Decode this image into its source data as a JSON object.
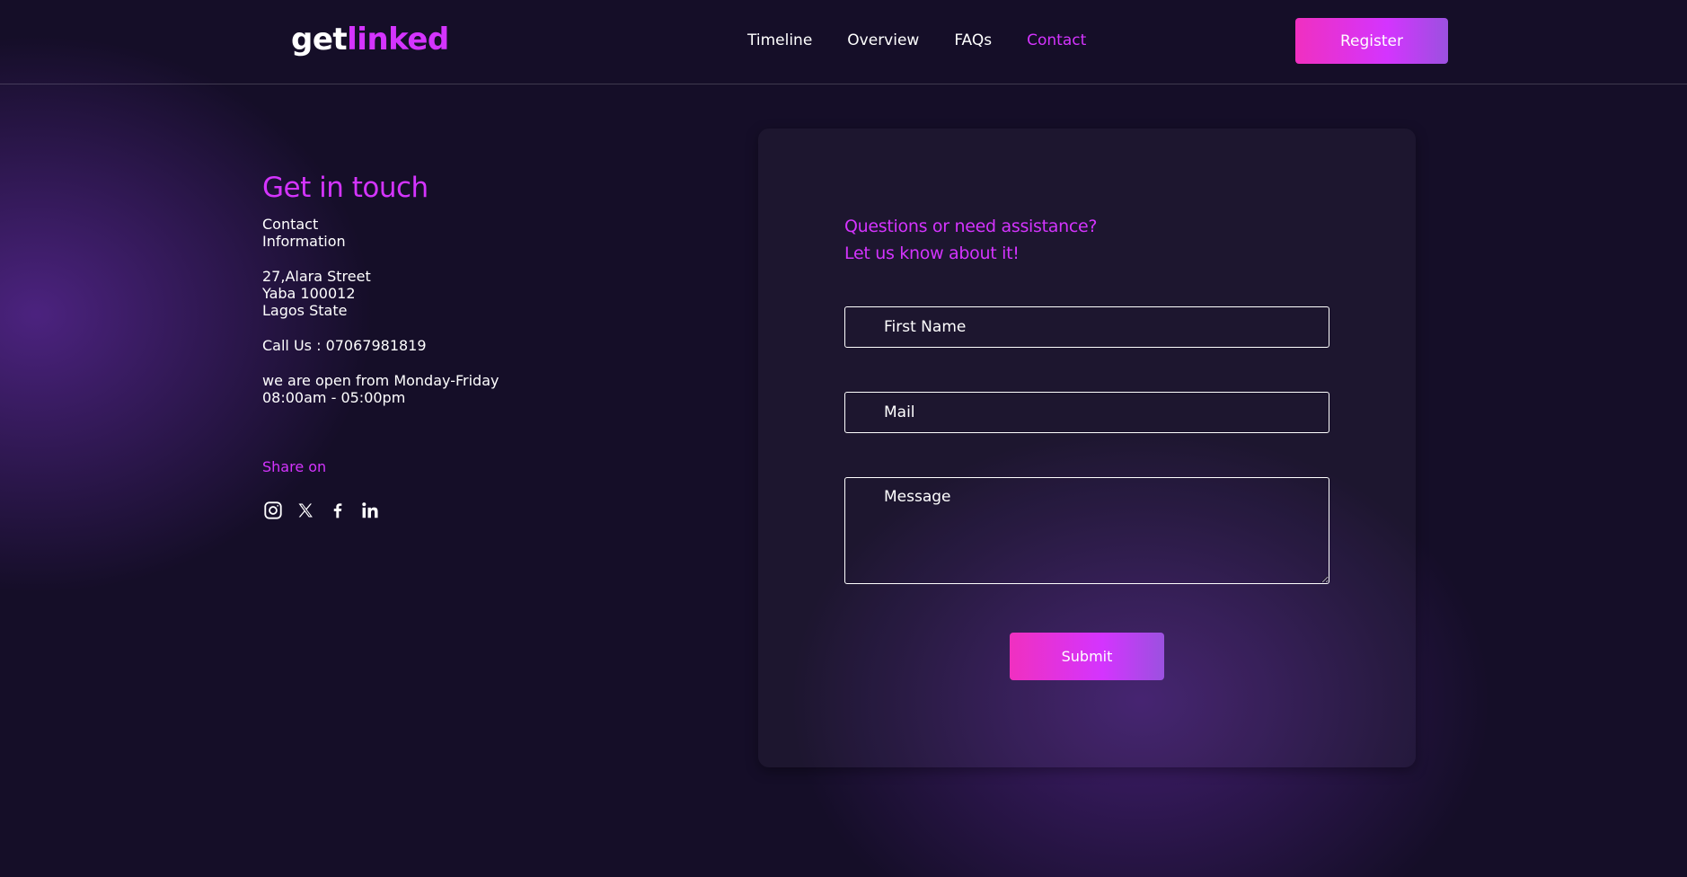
{
  "header": {
    "logo_part1": "get",
    "logo_part2": "linked",
    "nav": [
      {
        "label": "Timeline"
      },
      {
        "label": "Overview"
      },
      {
        "label": "FAQs"
      },
      {
        "label": "Contact",
        "active": true
      }
    ],
    "register_label": "Register"
  },
  "contact": {
    "title": "Get in touch",
    "info_label_line1": "Contact",
    "info_label_line2": "Information",
    "address_line1": "27,Alara Street",
    "address_line2": "Yaba 100012",
    "address_line3": "Lagos State",
    "phone": "Call Us : 07067981819",
    "hours_line1": "we are open from Monday-Friday",
    "hours_line2": "08:00am - 05:00pm",
    "share_label": "Share on",
    "socials": [
      "instagram-icon",
      "x-icon",
      "facebook-icon",
      "linkedin-icon"
    ]
  },
  "form": {
    "heading_line1": "Questions or need assistance?",
    "heading_line2": "Let us know about it!",
    "first_name_placeholder": "First Name",
    "mail_placeholder": "Mail",
    "message_placeholder": "Message",
    "submit_label": "Submit"
  },
  "colors": {
    "accent": "#d434fe",
    "background": "#150e28",
    "button_gradient_start": "#f030c0",
    "button_gradient_end": "#9b51e0"
  }
}
